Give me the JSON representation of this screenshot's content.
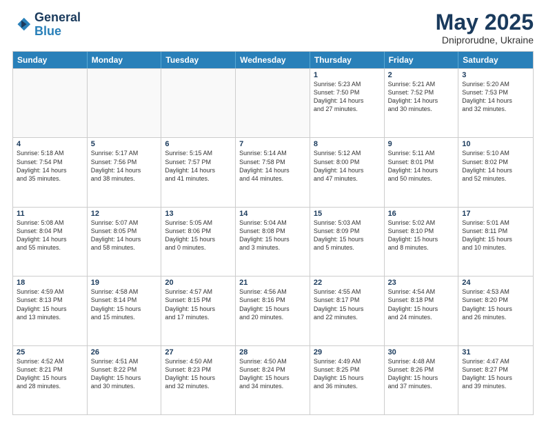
{
  "header": {
    "logo_line1": "General",
    "logo_line2": "Blue",
    "month": "May 2025",
    "location": "Dniprorudne, Ukraine"
  },
  "days_of_week": [
    "Sunday",
    "Monday",
    "Tuesday",
    "Wednesday",
    "Thursday",
    "Friday",
    "Saturday"
  ],
  "weeks": [
    [
      {
        "day": "",
        "text": ""
      },
      {
        "day": "",
        "text": ""
      },
      {
        "day": "",
        "text": ""
      },
      {
        "day": "",
        "text": ""
      },
      {
        "day": "1",
        "text": "Sunrise: 5:23 AM\nSunset: 7:50 PM\nDaylight: 14 hours\nand 27 minutes."
      },
      {
        "day": "2",
        "text": "Sunrise: 5:21 AM\nSunset: 7:52 PM\nDaylight: 14 hours\nand 30 minutes."
      },
      {
        "day": "3",
        "text": "Sunrise: 5:20 AM\nSunset: 7:53 PM\nDaylight: 14 hours\nand 32 minutes."
      }
    ],
    [
      {
        "day": "4",
        "text": "Sunrise: 5:18 AM\nSunset: 7:54 PM\nDaylight: 14 hours\nand 35 minutes."
      },
      {
        "day": "5",
        "text": "Sunrise: 5:17 AM\nSunset: 7:56 PM\nDaylight: 14 hours\nand 38 minutes."
      },
      {
        "day": "6",
        "text": "Sunrise: 5:15 AM\nSunset: 7:57 PM\nDaylight: 14 hours\nand 41 minutes."
      },
      {
        "day": "7",
        "text": "Sunrise: 5:14 AM\nSunset: 7:58 PM\nDaylight: 14 hours\nand 44 minutes."
      },
      {
        "day": "8",
        "text": "Sunrise: 5:12 AM\nSunset: 8:00 PM\nDaylight: 14 hours\nand 47 minutes."
      },
      {
        "day": "9",
        "text": "Sunrise: 5:11 AM\nSunset: 8:01 PM\nDaylight: 14 hours\nand 50 minutes."
      },
      {
        "day": "10",
        "text": "Sunrise: 5:10 AM\nSunset: 8:02 PM\nDaylight: 14 hours\nand 52 minutes."
      }
    ],
    [
      {
        "day": "11",
        "text": "Sunrise: 5:08 AM\nSunset: 8:04 PM\nDaylight: 14 hours\nand 55 minutes."
      },
      {
        "day": "12",
        "text": "Sunrise: 5:07 AM\nSunset: 8:05 PM\nDaylight: 14 hours\nand 58 minutes."
      },
      {
        "day": "13",
        "text": "Sunrise: 5:05 AM\nSunset: 8:06 PM\nDaylight: 15 hours\nand 0 minutes."
      },
      {
        "day": "14",
        "text": "Sunrise: 5:04 AM\nSunset: 8:08 PM\nDaylight: 15 hours\nand 3 minutes."
      },
      {
        "day": "15",
        "text": "Sunrise: 5:03 AM\nSunset: 8:09 PM\nDaylight: 15 hours\nand 5 minutes."
      },
      {
        "day": "16",
        "text": "Sunrise: 5:02 AM\nSunset: 8:10 PM\nDaylight: 15 hours\nand 8 minutes."
      },
      {
        "day": "17",
        "text": "Sunrise: 5:01 AM\nSunset: 8:11 PM\nDaylight: 15 hours\nand 10 minutes."
      }
    ],
    [
      {
        "day": "18",
        "text": "Sunrise: 4:59 AM\nSunset: 8:13 PM\nDaylight: 15 hours\nand 13 minutes."
      },
      {
        "day": "19",
        "text": "Sunrise: 4:58 AM\nSunset: 8:14 PM\nDaylight: 15 hours\nand 15 minutes."
      },
      {
        "day": "20",
        "text": "Sunrise: 4:57 AM\nSunset: 8:15 PM\nDaylight: 15 hours\nand 17 minutes."
      },
      {
        "day": "21",
        "text": "Sunrise: 4:56 AM\nSunset: 8:16 PM\nDaylight: 15 hours\nand 20 minutes."
      },
      {
        "day": "22",
        "text": "Sunrise: 4:55 AM\nSunset: 8:17 PM\nDaylight: 15 hours\nand 22 minutes."
      },
      {
        "day": "23",
        "text": "Sunrise: 4:54 AM\nSunset: 8:18 PM\nDaylight: 15 hours\nand 24 minutes."
      },
      {
        "day": "24",
        "text": "Sunrise: 4:53 AM\nSunset: 8:20 PM\nDaylight: 15 hours\nand 26 minutes."
      }
    ],
    [
      {
        "day": "25",
        "text": "Sunrise: 4:52 AM\nSunset: 8:21 PM\nDaylight: 15 hours\nand 28 minutes."
      },
      {
        "day": "26",
        "text": "Sunrise: 4:51 AM\nSunset: 8:22 PM\nDaylight: 15 hours\nand 30 minutes."
      },
      {
        "day": "27",
        "text": "Sunrise: 4:50 AM\nSunset: 8:23 PM\nDaylight: 15 hours\nand 32 minutes."
      },
      {
        "day": "28",
        "text": "Sunrise: 4:50 AM\nSunset: 8:24 PM\nDaylight: 15 hours\nand 34 minutes."
      },
      {
        "day": "29",
        "text": "Sunrise: 4:49 AM\nSunset: 8:25 PM\nDaylight: 15 hours\nand 36 minutes."
      },
      {
        "day": "30",
        "text": "Sunrise: 4:48 AM\nSunset: 8:26 PM\nDaylight: 15 hours\nand 37 minutes."
      },
      {
        "day": "31",
        "text": "Sunrise: 4:47 AM\nSunset: 8:27 PM\nDaylight: 15 hours\nand 39 minutes."
      }
    ]
  ]
}
